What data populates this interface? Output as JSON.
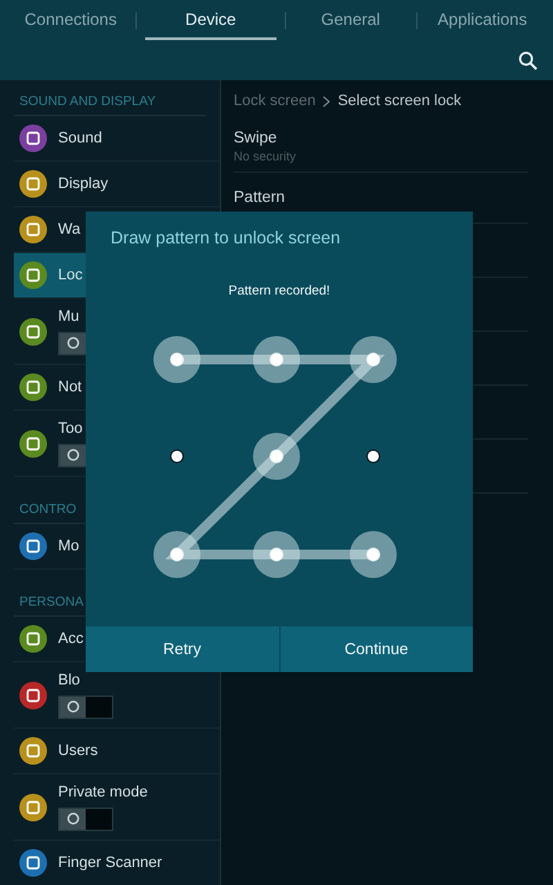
{
  "tabs": [
    {
      "label": "Connections",
      "selected": false
    },
    {
      "label": "Device",
      "selected": true
    },
    {
      "label": "General",
      "selected": false
    },
    {
      "label": "Applications",
      "selected": false
    }
  ],
  "sidebar": {
    "sections": [
      {
        "header": "SOUND AND DISPLAY",
        "items": [
          {
            "label": "Sound",
            "color": "#7b3fa0",
            "selected": false,
            "kind": "plain"
          },
          {
            "label": "Display",
            "color": "#b8901c",
            "selected": false,
            "kind": "plain"
          },
          {
            "label": "Wa",
            "color": "#b8901c",
            "selected": false,
            "kind": "plain"
          },
          {
            "label": "Loc",
            "color": "#5a8a20",
            "selected": true,
            "kind": "plain"
          },
          {
            "label": "Mu",
            "color": "#5a8a20",
            "selected": false,
            "kind": "toggle",
            "on": false
          },
          {
            "label": "Not",
            "color": "#5a8a20",
            "selected": false,
            "kind": "plain"
          },
          {
            "label": "Too",
            "color": "#5a8a20",
            "selected": false,
            "kind": "toggle",
            "on": false
          }
        ]
      },
      {
        "header": "CONTRO",
        "items": [
          {
            "label": "Mo",
            "color": "#1d6fb0",
            "selected": false,
            "kind": "plain"
          }
        ]
      },
      {
        "header": "PERSONA",
        "items": [
          {
            "label": "Acc",
            "color": "#5a8a20",
            "selected": false,
            "kind": "plain"
          },
          {
            "label": "Blo",
            "color": "#b82828",
            "selected": false,
            "kind": "toggle",
            "on": false
          },
          {
            "label": "Users",
            "color": "#b8901c",
            "selected": false,
            "kind": "plain"
          },
          {
            "label": "Private mode",
            "color": "#b8901c",
            "selected": false,
            "kind": "toggle",
            "on": false
          },
          {
            "label": "Finger Scanner",
            "color": "#1d6fb0",
            "selected": false,
            "kind": "plain"
          }
        ]
      }
    ]
  },
  "breadcrumb": [
    "Lock screen",
    "Select screen lock"
  ],
  "options": [
    {
      "title": "Swipe",
      "subtitle": "No security"
    },
    {
      "title": "Pattern"
    }
  ],
  "dialog": {
    "title": "Draw pattern to unlock screen",
    "message": "Pattern recorded!",
    "dots": [
      {
        "selected": true
      },
      {
        "selected": true
      },
      {
        "selected": true
      },
      {
        "selected": false
      },
      {
        "selected": true
      },
      {
        "selected": false
      },
      {
        "selected": true
      },
      {
        "selected": true
      },
      {
        "selected": true
      }
    ],
    "buttons": [
      "Retry",
      "Continue"
    ]
  }
}
